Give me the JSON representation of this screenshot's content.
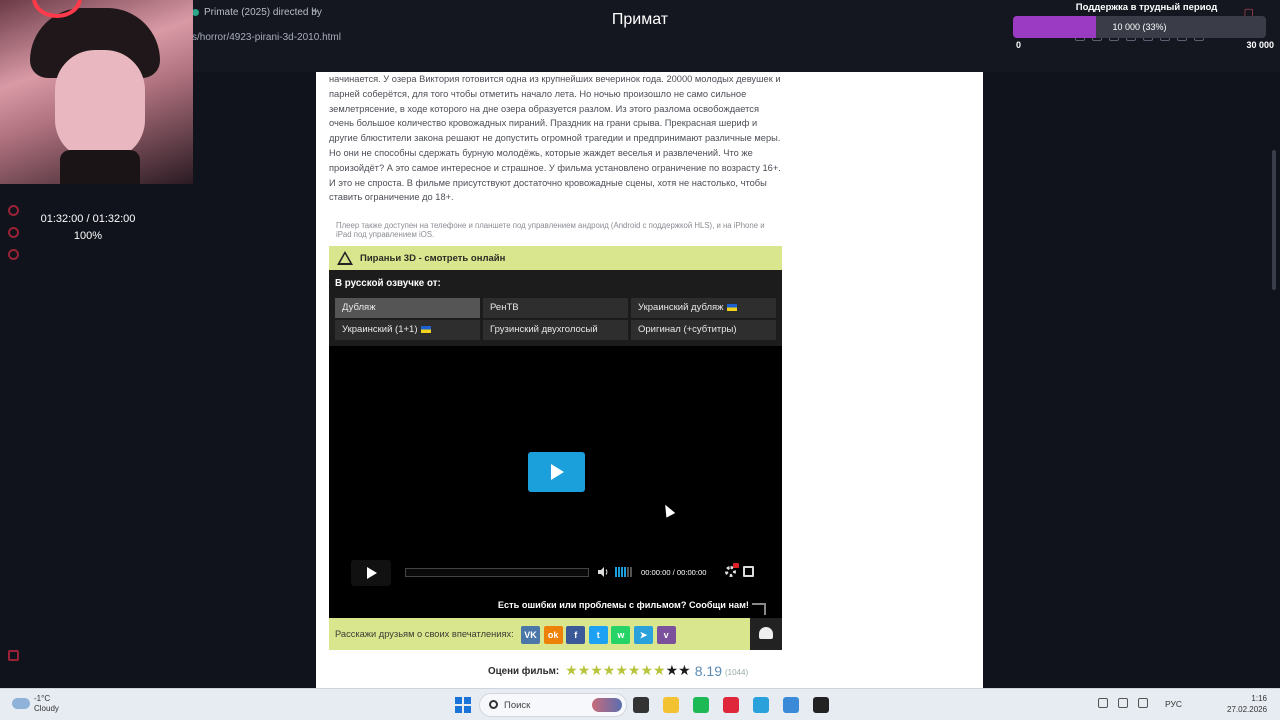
{
  "browser": {
    "tab_title": "Primate (2025) directed by",
    "url": "s/horror/4923-pirani-3d-2010.html"
  },
  "overlay": {
    "stream_title": "Примат",
    "timer": "01:32:00 / 01:32:00",
    "percent": "100%",
    "goal_title": "Поддержка в трудный период",
    "goal_value": "10 000  (33%)",
    "goal_progress": 0.33,
    "goal_min": "0",
    "goal_max": "30 000"
  },
  "page": {
    "description": "начинается. У озера Виктория готовится одна из крупнейших вечеринок года. 20000 молодых девушек и парней соберётся, для того чтобы отметить начало лета. Но ночью произошло не само сильное землетрясение, в ходе которого на дне озера образуется разлом. Из этого разлома освобождается очень большое количество кровожадных пираний. Праздник на грани срыва. Прекрасная шериф и другие блюстители закона решают не допустить огромной трагедии и предпринимают различные меры. Но они не способны сдержать бурную молодёжь, которые жаждет веселья и развлечений. Что же произойдёт? А это самое интересное и страшное. У фильма установлено ограничение по возрасту 16+. И это не спроста. В фильме присутствуют достаточно кровожадные сцены, хотя не настолько, чтобы ставить ограничение до 18+.",
    "player_hint": "Плеер также доступен на телефоне и планшете под управлением андроид (Android с поддержкой HLS), и на iPhone и iPad под управлением iOS.",
    "player_title": "Пираньи 3D - смотреть онлайн",
    "voice_title": "В русской озвучке от:",
    "voices": [
      {
        "label": "Дубляж",
        "flag": false
      },
      {
        "label": "РенТВ",
        "flag": false
      },
      {
        "label": "Украинский дубляж",
        "flag": true
      },
      {
        "label": "Украинский (1+1)",
        "flag": true
      },
      {
        "label": "Грузинский двухголосый",
        "flag": false
      },
      {
        "label": "Оригинал (+субтитры)",
        "flag": false
      }
    ],
    "video_time": "00:00:00 / 00:00:00",
    "error_text": "Есть ошибки или проблемы с фильмом? Сообщи нам!",
    "share_label": "Расскажи друзьям о своих впечатлениях:",
    "share_buttons": [
      {
        "name": "vk-icon",
        "glyph": "VK",
        "color": "#4a76a8"
      },
      {
        "name": "odnoklassniki-icon",
        "glyph": "ok",
        "color": "#ee8208"
      },
      {
        "name": "facebook-icon",
        "glyph": "f",
        "color": "#3b5998"
      },
      {
        "name": "twitter-icon",
        "glyph": "t",
        "color": "#1da1f2"
      },
      {
        "name": "whatsapp-icon",
        "glyph": "w",
        "color": "#25d366"
      },
      {
        "name": "telegram-icon",
        "glyph": "➤",
        "color": "#2aa1da"
      },
      {
        "name": "viber-icon",
        "glyph": "v",
        "color": "#7b519d"
      }
    ],
    "rating_label": "Оцени фильм:",
    "rating_stars_total": 10,
    "rating_stars_filled": 8,
    "rating_score": "8.19",
    "rating_votes": "(1044)"
  },
  "taskbar": {
    "temperature": "-1°C",
    "weather": "Cloudy",
    "search_placeholder": "Поиск",
    "lang": "РУС",
    "time": "1:16",
    "date": "27.02.2026",
    "apps": [
      {
        "name": "task-view-icon",
        "color": "#333333"
      },
      {
        "name": "file-explorer-icon",
        "color": "#f2c232"
      },
      {
        "name": "spotify-icon",
        "color": "#1db954"
      },
      {
        "name": "opera-icon",
        "color": "#e0263a"
      },
      {
        "name": "telegram-app-icon",
        "color": "#2aa1da"
      },
      {
        "name": "notepad-icon",
        "color": "#3a8ad8"
      },
      {
        "name": "obs-icon",
        "color": "#222222"
      }
    ]
  }
}
